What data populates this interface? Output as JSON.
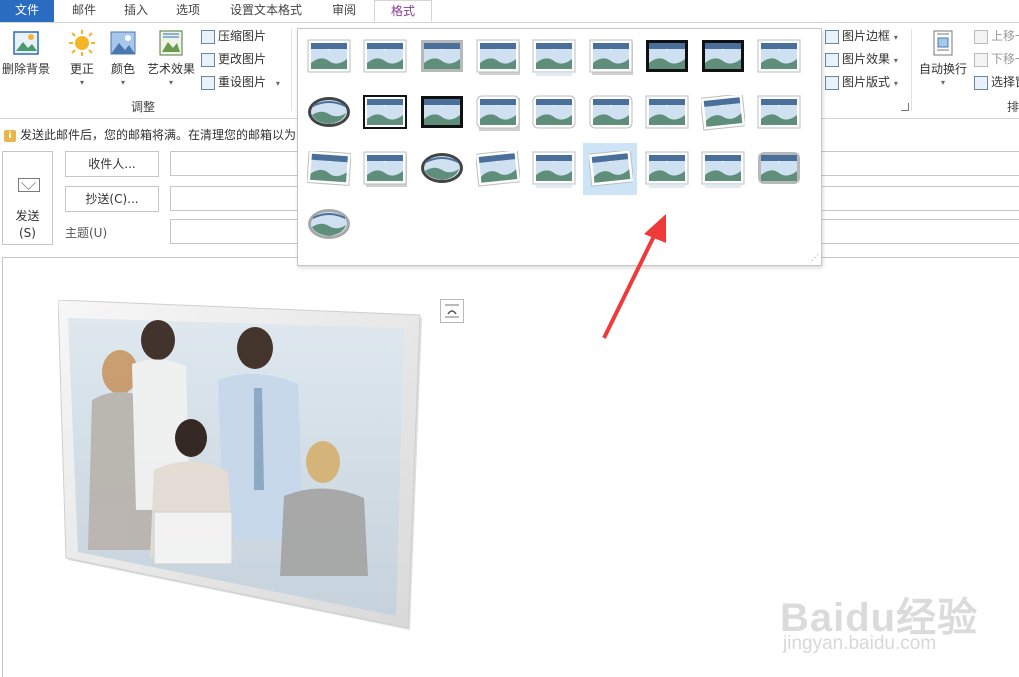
{
  "tabs": [
    "文件",
    "邮件",
    "插入",
    "选项",
    "设置文本格式",
    "审阅",
    "格式"
  ],
  "ribbon": {
    "remove_bg": "删除背景",
    "correct": "更正",
    "color": "颜色",
    "artistic": "艺术效果",
    "compress": "压缩图片",
    "change": "更改图片",
    "reset": "重设图片",
    "adjust_group": "调整",
    "picture_border": "图片边框",
    "picture_effects": "图片效果",
    "picture_layout": "图片版式",
    "wrap_text": "自动换行",
    "bring_forward": "上移一",
    "send_backward": "下移一",
    "selection_pane": "选择窗",
    "arrange_group": "排"
  },
  "infobar": {
    "message": "发送此邮件后，您的邮箱将满。在清理您的邮箱以为"
  },
  "compose": {
    "send_label": "发送",
    "send_key": "(S)",
    "to_button": "收件人...",
    "cc_button": "抄送(C)...",
    "subject_label": "主题(U)",
    "to_value": "",
    "cc_value": "",
    "subject_value": ""
  },
  "gallery": {
    "selected_index": 23
  },
  "colors": {
    "file_tab": "#2a6cc0",
    "active_tab_text": "#8a3a94",
    "arrow": "#f03a3a",
    "gallery_selected": "#cde4f7"
  },
  "watermark": {
    "brand": "Baidu经验",
    "url": "jingyan.baidu.com"
  }
}
